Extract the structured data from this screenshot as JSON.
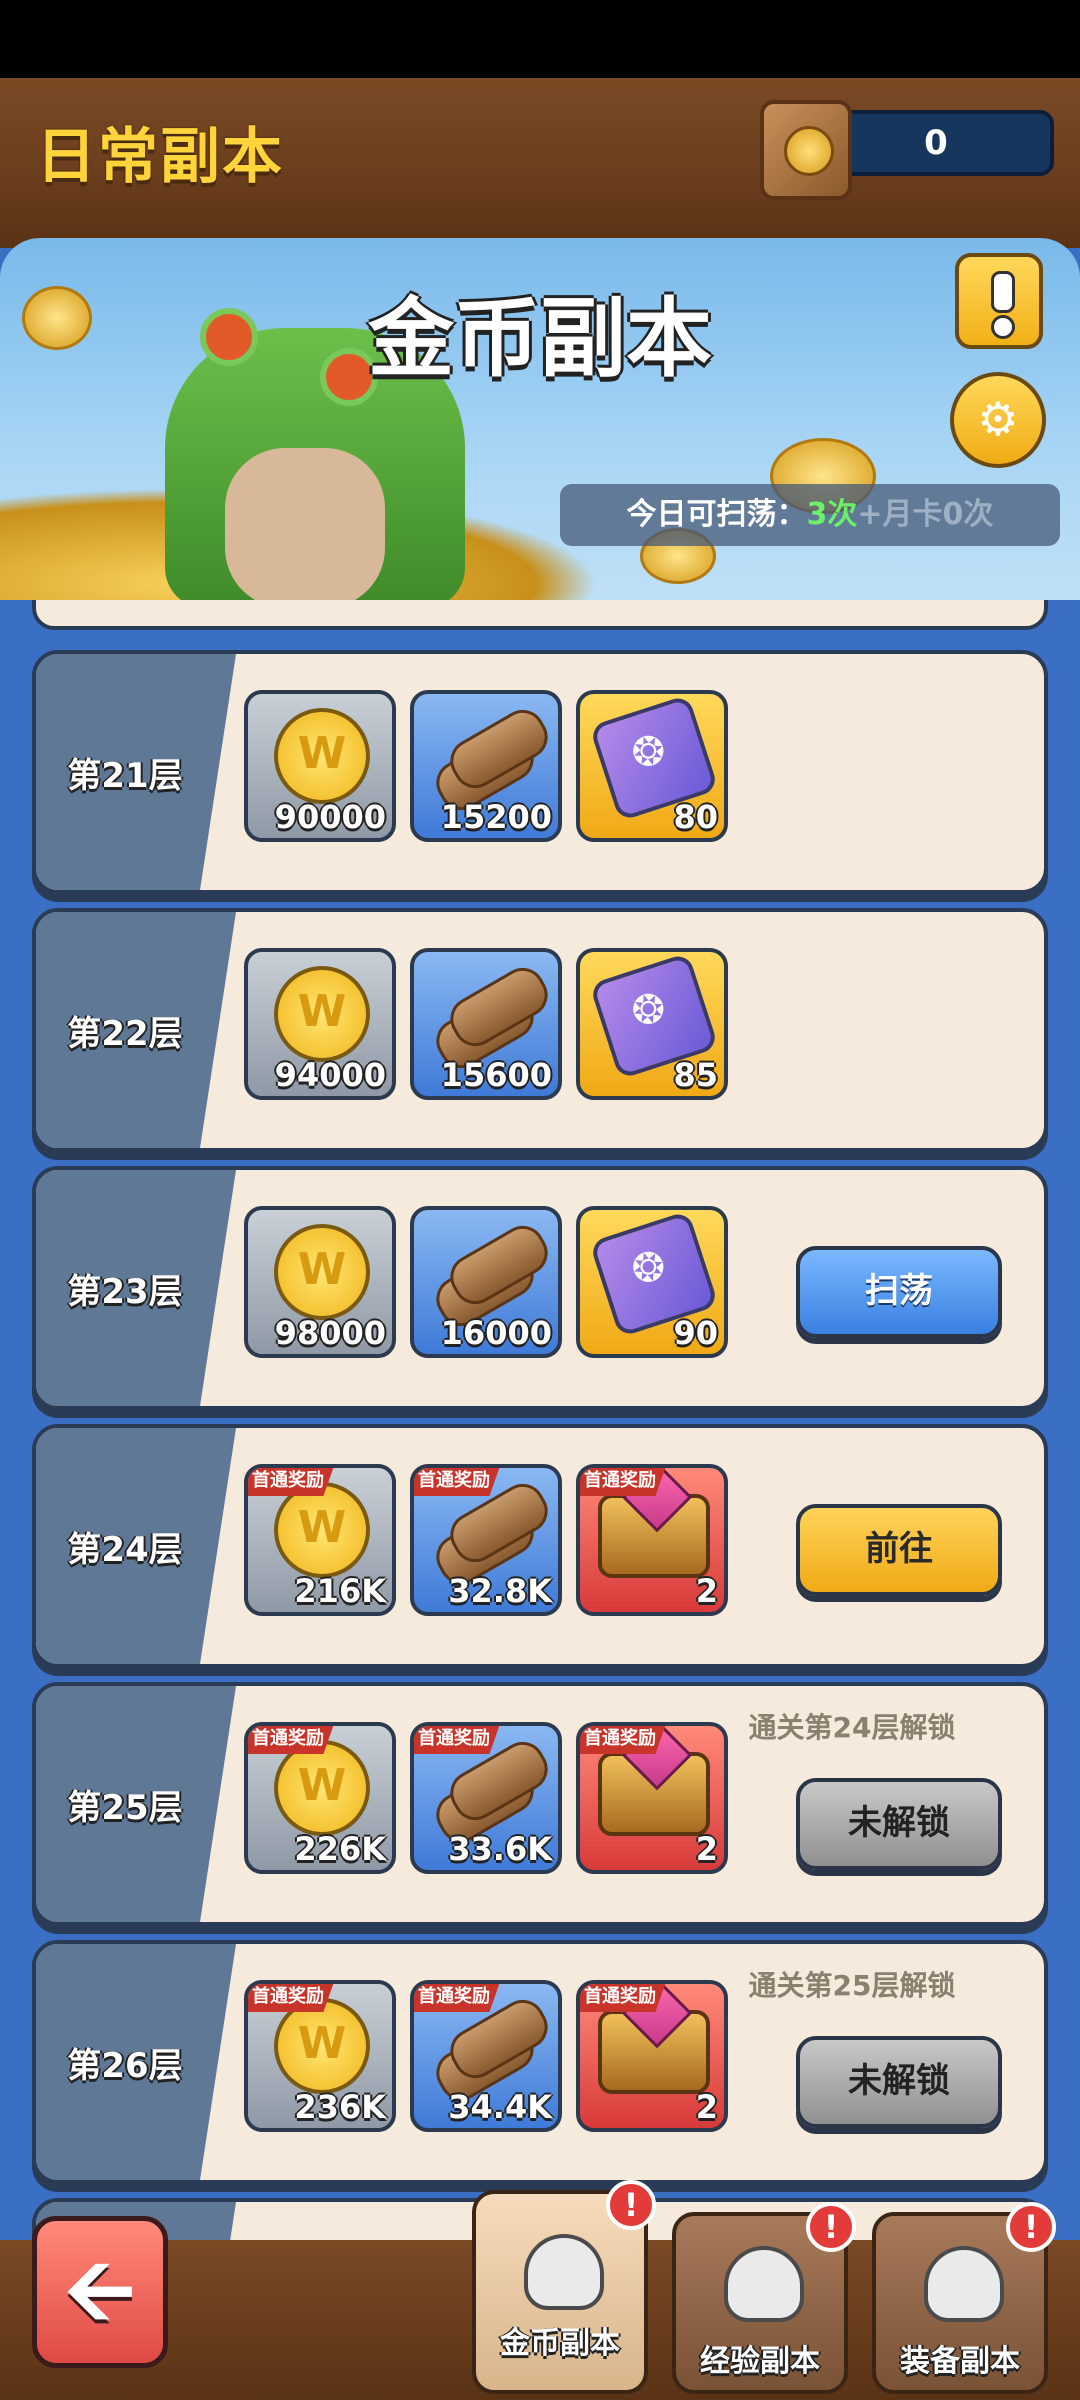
{
  "header": {
    "title": "日常副本",
    "ticket_count": "0"
  },
  "banner": {
    "title": "金币副本",
    "sweep_prefix": "今日可扫荡：",
    "sweep_count": "3次",
    "sweep_suffix": "+月卡0次"
  },
  "floors": [
    {
      "label": "第21层",
      "rewards": [
        {
          "type": "coin",
          "qty": "90000",
          "first": false
        },
        {
          "type": "wood",
          "qty": "15200",
          "first": false
        },
        {
          "type": "scroll",
          "qty": "80",
          "first": false
        }
      ]
    },
    {
      "label": "第22层",
      "rewards": [
        {
          "type": "coin",
          "qty": "94000",
          "first": false
        },
        {
          "type": "wood",
          "qty": "15600",
          "first": false
        },
        {
          "type": "scroll",
          "qty": "85",
          "first": false
        }
      ]
    },
    {
      "label": "第23层",
      "action": "扫荡",
      "rewards": [
        {
          "type": "coin",
          "qty": "98000",
          "first": false
        },
        {
          "type": "wood",
          "qty": "16000",
          "first": false
        },
        {
          "type": "scroll",
          "qty": "90",
          "first": false
        }
      ]
    },
    {
      "label": "第24层",
      "action": "前往",
      "rewards": [
        {
          "type": "coin",
          "qty": "216K",
          "first": true
        },
        {
          "type": "wood",
          "qty": "32.8K",
          "first": true
        },
        {
          "type": "chest",
          "qty": "2",
          "first": true
        }
      ]
    },
    {
      "label": "第25层",
      "action": "未解锁",
      "hint": "通关第24层解锁",
      "rewards": [
        {
          "type": "coin",
          "qty": "226K",
          "first": true
        },
        {
          "type": "wood",
          "qty": "33.6K",
          "first": true
        },
        {
          "type": "chest",
          "qty": "2",
          "first": true
        }
      ]
    },
    {
      "label": "第26层",
      "action": "未解锁",
      "hint": "通关第25层解锁",
      "rewards": [
        {
          "type": "coin",
          "qty": "236K",
          "first": true
        },
        {
          "type": "wood",
          "qty": "34.4K",
          "first": true
        },
        {
          "type": "chest",
          "qty": "2",
          "first": true
        }
      ]
    }
  ],
  "first_reward_tag": "首通奖励",
  "tabs": [
    {
      "label": "金币副本",
      "badge": "!"
    },
    {
      "label": "经验副本",
      "badge": "!"
    },
    {
      "label": "装备副本",
      "badge": "!"
    }
  ],
  "back_icon": "arrow-left-icon"
}
